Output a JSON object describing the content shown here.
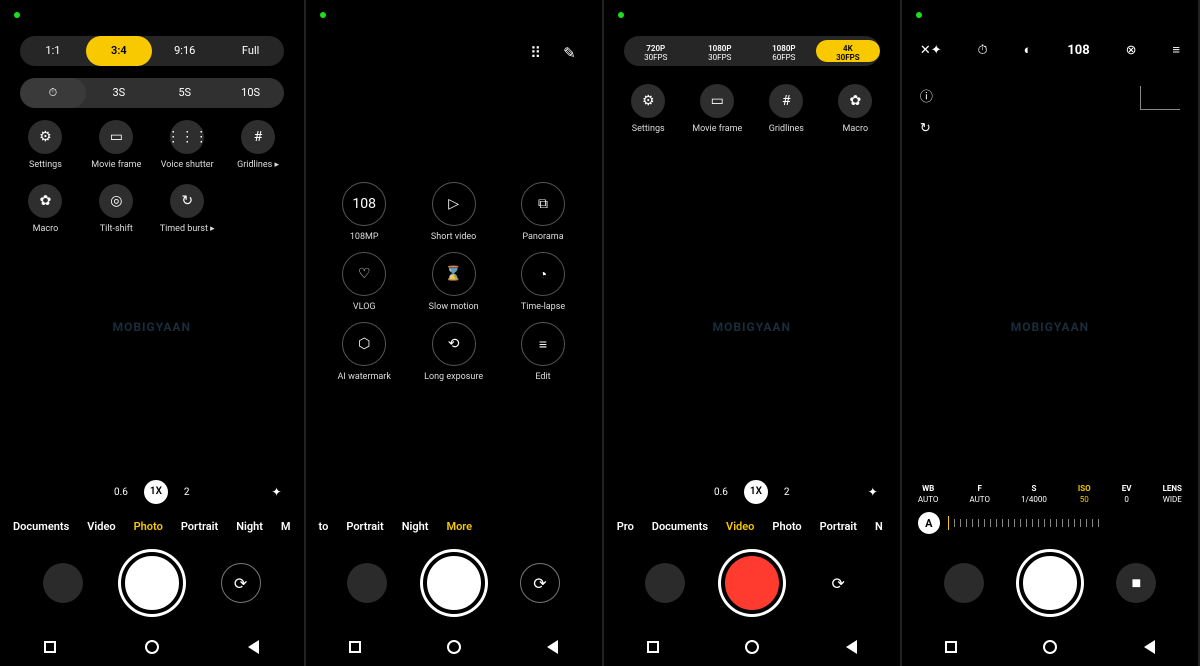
{
  "watermark": "MOBIGYAAN",
  "phone1": {
    "aspect": {
      "items": [
        "1:1",
        "3:4",
        "9:16",
        "Full"
      ],
      "selected": 1
    },
    "timer": {
      "items": [
        "⏱",
        "3S",
        "5S",
        "10S"
      ],
      "selected": 0
    },
    "grid1": [
      {
        "icon": "⚙",
        "label": "Settings"
      },
      {
        "icon": "▭",
        "label": "Movie frame"
      },
      {
        "icon": "⋮⋮⋮",
        "label": "Voice shutter"
      },
      {
        "icon": "#",
        "label": "Gridlines ▸"
      }
    ],
    "grid2": [
      {
        "icon": "✿",
        "label": "Macro"
      },
      {
        "icon": "◎",
        "label": "Tilt-shift"
      },
      {
        "icon": "↻",
        "label": "Timed burst ▸"
      }
    ],
    "zoom": {
      "items": [
        "0.6",
        "1X",
        "2"
      ],
      "selected": 1
    },
    "modes": {
      "items": [
        "Documents",
        "Video",
        "Photo",
        "Portrait",
        "Night",
        "M"
      ],
      "selected": 2
    }
  },
  "phone2": {
    "top_icons": {
      "grid": "⠿",
      "edit": "✎"
    },
    "grid1": [
      {
        "icon": "108",
        "label": "108MP"
      },
      {
        "icon": "▷",
        "label": "Short video"
      },
      {
        "icon": "⧉",
        "label": "Panorama"
      }
    ],
    "grid2": [
      {
        "icon": "♡",
        "label": "VLOG"
      },
      {
        "icon": "⌛",
        "label": "Slow motion"
      },
      {
        "icon": "◔",
        "label": "Time-lapse"
      }
    ],
    "grid3": [
      {
        "icon": "⬡",
        "label": "AI watermark"
      },
      {
        "icon": "⟲",
        "label": "Long exposure"
      },
      {
        "icon": "≡",
        "label": "Edit"
      }
    ],
    "modes": {
      "items": [
        "to",
        "Portrait",
        "Night",
        "More"
      ],
      "selected": 3
    }
  },
  "phone3": {
    "res": {
      "items": [
        {
          "t": "720P",
          "b": "30FPS"
        },
        {
          "t": "1080P",
          "b": "30FPS"
        },
        {
          "t": "1080P",
          "b": "60FPS"
        },
        {
          "t": "4K",
          "b": "30FPS"
        }
      ],
      "selected": 3
    },
    "grid": [
      {
        "icon": "⚙",
        "label": "Settings"
      },
      {
        "icon": "▭",
        "label": "Movie frame"
      },
      {
        "icon": "#",
        "label": "Gridlines"
      },
      {
        "icon": "✿",
        "label": "Macro"
      }
    ],
    "zoom": {
      "items": [
        "0.6",
        "1X",
        "2"
      ],
      "selected": 1
    },
    "modes": {
      "items": [
        "Pro",
        "Documents",
        "Video",
        "Photo",
        "Portrait",
        "N"
      ],
      "selected": 2
    }
  },
  "phone4": {
    "topbar": {
      "flash": "✕✦",
      "timer": "⏱",
      "focus": "◐",
      "mp": "108",
      "color": "⊗",
      "menu": "≡"
    },
    "side": {
      "info": "ⓘ",
      "reset": "↻"
    },
    "params": [
      {
        "k": "WB",
        "v": "AUTO"
      },
      {
        "k": "F",
        "v": "AUTO"
      },
      {
        "k": "S",
        "v": "1/4000"
      },
      {
        "k": "ISO",
        "v": "50",
        "sel": true
      },
      {
        "k": "EV",
        "v": "0"
      },
      {
        "k": "LENS",
        "v": "WIDE"
      }
    ],
    "auto_btn": "A",
    "video_icon": "■"
  }
}
